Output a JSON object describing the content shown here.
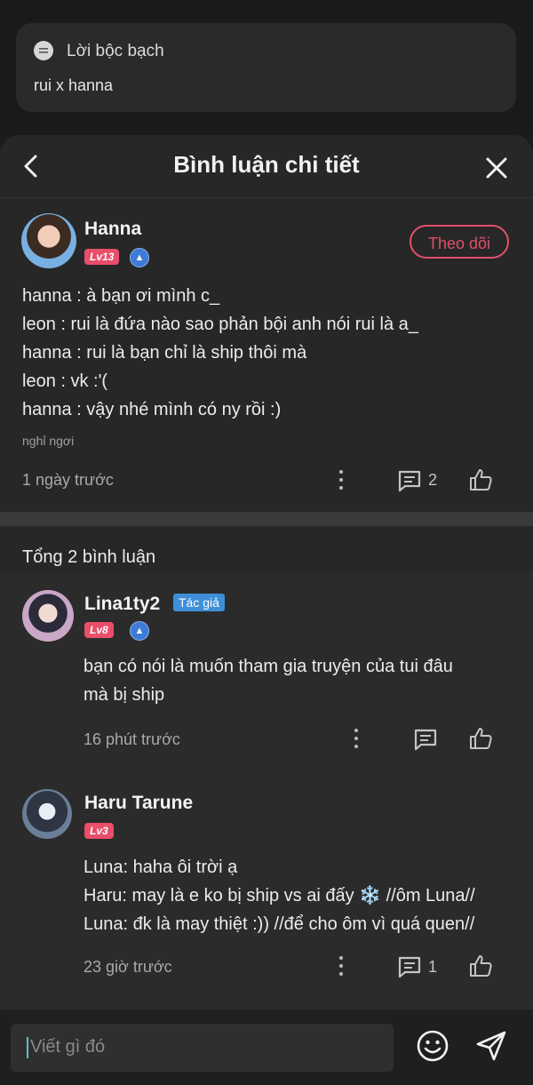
{
  "preview": {
    "category": "Lời bộc bạch",
    "title": "rui x hanna"
  },
  "header": {
    "title": "Bình luận chi tiết"
  },
  "main_comment": {
    "author": "Hanna",
    "level": "Lv13",
    "follow_label": "Theo dõi",
    "lines": [
      "hanna : à bạn ơi mình c_",
      "leon : rui là đứa nào sao phản bội anh nói rui là a_",
      "hanna : rui là bạn chỉ là ship thôi mà",
      "leon : vk :'(",
      "hanna : vậy nhé mình có ny rồi :)"
    ],
    "tag": "nghỉ ngơi",
    "time": "1 ngày trước",
    "reply_count": "2"
  },
  "total_label": "Tổng 2 bình luận",
  "replies": [
    {
      "author": "Lina1ty2",
      "author_badge": "Tác giả",
      "level": "Lv8",
      "lines": [
        "bạn có nói là muốn tham gia truyện của tui đâu",
        "mà bị ship"
      ],
      "time": "16 phút trước"
    },
    {
      "author": "Haru Tarune",
      "level": "Lv3",
      "lines": [
        "Luna: haha ôi trời ạ",
        "Haru: may là e ko bị ship vs ai đấy ❄️ //ôm Luna//",
        "Luna: đk là may thiệt :)) //để cho ôm vì quá quen//"
      ],
      "time": "23 giờ trước",
      "reply_count": "1"
    }
  ],
  "composer": {
    "placeholder": "Viết gì đó"
  },
  "colors": {
    "accent": "#e2506a",
    "level_badge": "#e94e6a",
    "author_badge": "#3e8fd8",
    "sheet_bg": "#272727"
  }
}
